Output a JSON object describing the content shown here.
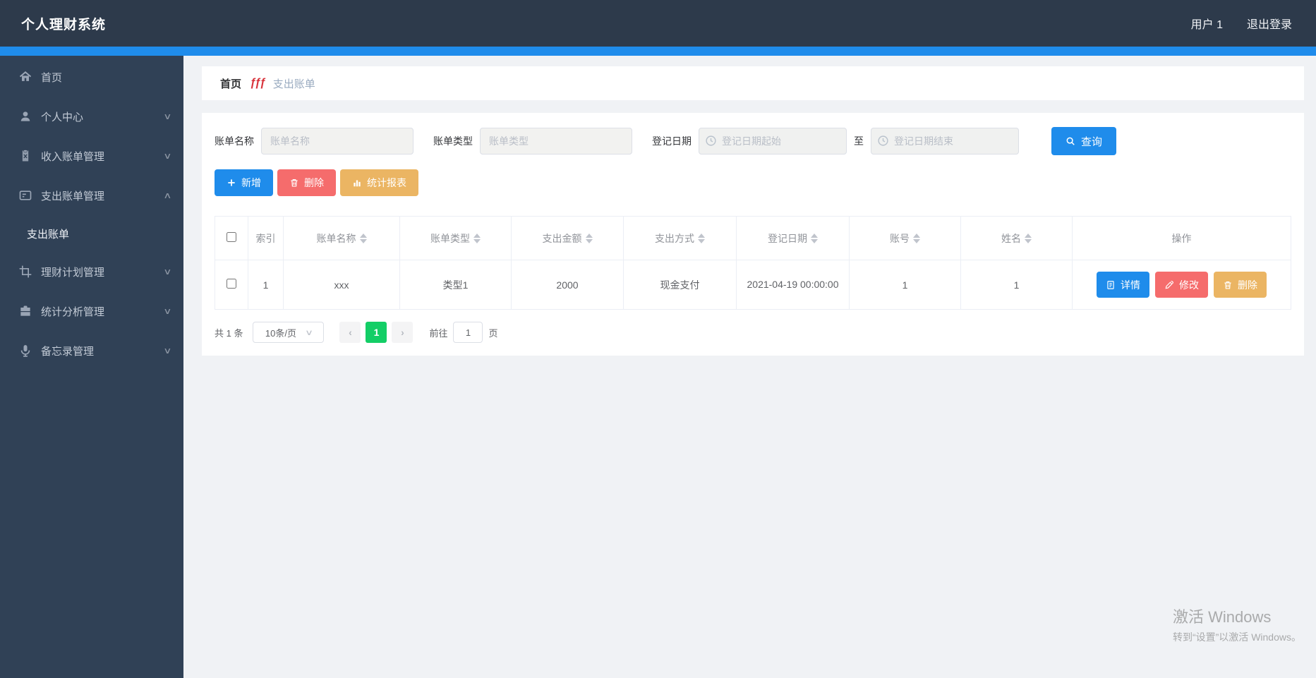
{
  "header": {
    "title": "个人理财系统",
    "user": "用户 1",
    "logout": "退出登录"
  },
  "sidebar": {
    "items": [
      {
        "label": "首页",
        "icon": "home-icon",
        "expandable": false
      },
      {
        "label": "个人中心",
        "icon": "user-icon",
        "expandable": true,
        "state": "collapsed"
      },
      {
        "label": "收入账单管理",
        "icon": "clipboard-icon",
        "expandable": true,
        "state": "collapsed"
      },
      {
        "label": "支出账单管理",
        "icon": "card-icon",
        "expandable": true,
        "state": "expanded"
      },
      {
        "label": "理财计划管理",
        "icon": "crop-icon",
        "expandable": true,
        "state": "collapsed"
      },
      {
        "label": "统计分析管理",
        "icon": "briefcase-icon",
        "expandable": true,
        "state": "collapsed"
      },
      {
        "label": "备忘录管理",
        "icon": "microphone-icon",
        "expandable": true,
        "state": "collapsed"
      }
    ],
    "submenu": {
      "label": "支出账单",
      "active": true
    }
  },
  "breadcrumb": {
    "home": "首页",
    "separator": "ƒƒƒ",
    "current": "支出账单"
  },
  "search": {
    "name_label": "账单名称",
    "name_placeholder": "账单名称",
    "type_label": "账单类型",
    "type_placeholder": "账单类型",
    "date_label": "登记日期",
    "date_start_placeholder": "登记日期起始",
    "to_label": "至",
    "date_end_placeholder": "登记日期结束",
    "query_label": "查询"
  },
  "toolbar": {
    "add_label": "新增",
    "delete_label": "删除",
    "report_label": "统计报表"
  },
  "table": {
    "headers": [
      "索引",
      "账单名称",
      "账单类型",
      "支出金额",
      "支出方式",
      "登记日期",
      "账号",
      "姓名",
      "操作"
    ],
    "rows": [
      {
        "index": "1",
        "name": "xxx",
        "type": "类型1",
        "amount": "2000",
        "method": "现金支付",
        "date": "2021-04-19 00:00:00",
        "account": "1",
        "person": "1"
      }
    ],
    "row_actions": {
      "detail": "详情",
      "edit": "修改",
      "delete": "删除"
    }
  },
  "pagination": {
    "total": "共 1 条",
    "page_size": "10条/页",
    "prev": "‹",
    "next": "›",
    "current_page": "1",
    "goto_label": "前往",
    "goto_value": "1",
    "page_label": "页"
  },
  "watermark": {
    "line1": "激活 Windows",
    "line2": "转到“设置”以激活 Windows。"
  },
  "colors": {
    "accent_blue": "#1f8ceb",
    "danger_red": "#f56c6c",
    "warning_yellow": "#ebb563",
    "success_green": "#13ce66",
    "navbar": "#2d3a4b",
    "sidebar": "#304156"
  }
}
